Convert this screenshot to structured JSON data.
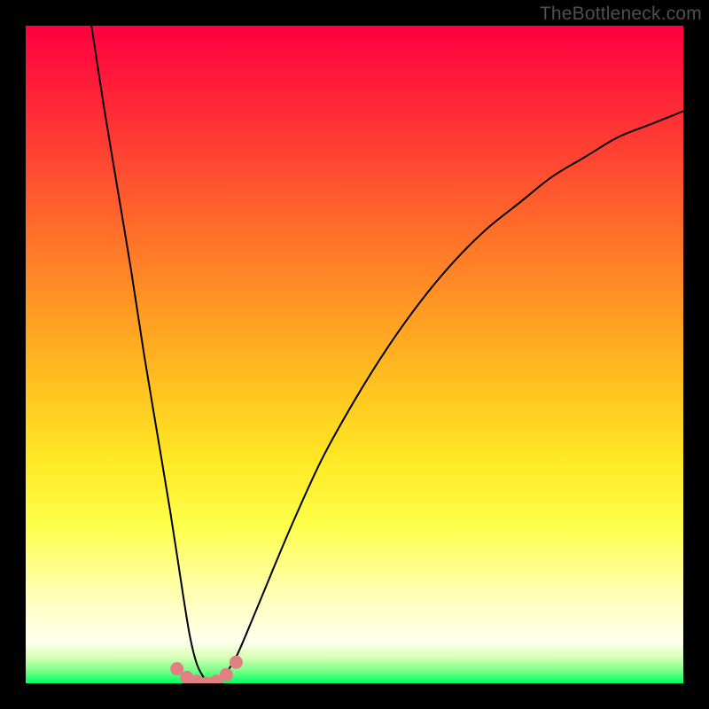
{
  "watermark": "TheBottleneck.com",
  "chart_data": {
    "type": "line",
    "title": "",
    "xlabel": "",
    "ylabel": "",
    "xlim": [
      0,
      100
    ],
    "ylim": [
      0,
      100
    ],
    "grid": false,
    "series": [
      {
        "name": "curve",
        "x": [
          10,
          12,
          14,
          16,
          18,
          20,
          22,
          24,
          25,
          26,
          27,
          28,
          29,
          30,
          32,
          35,
          40,
          45,
          50,
          55,
          60,
          65,
          70,
          75,
          80,
          85,
          90,
          95,
          100
        ],
        "y": [
          100,
          87,
          75,
          63,
          50,
          38,
          26,
          13,
          7,
          3,
          1,
          0,
          0,
          1,
          4,
          11,
          23,
          34,
          43,
          51,
          58,
          64,
          69,
          73,
          77,
          80,
          83,
          85,
          87
        ]
      }
    ],
    "markers": {
      "name": "floor-dots",
      "color": "#e08080",
      "x": [
        23.0,
        24.5,
        26.0,
        27.5,
        29.0,
        30.5,
        32.0
      ],
      "y": [
        2.2,
        0.9,
        0.3,
        0.0,
        0.3,
        1.3,
        3.2
      ]
    }
  }
}
